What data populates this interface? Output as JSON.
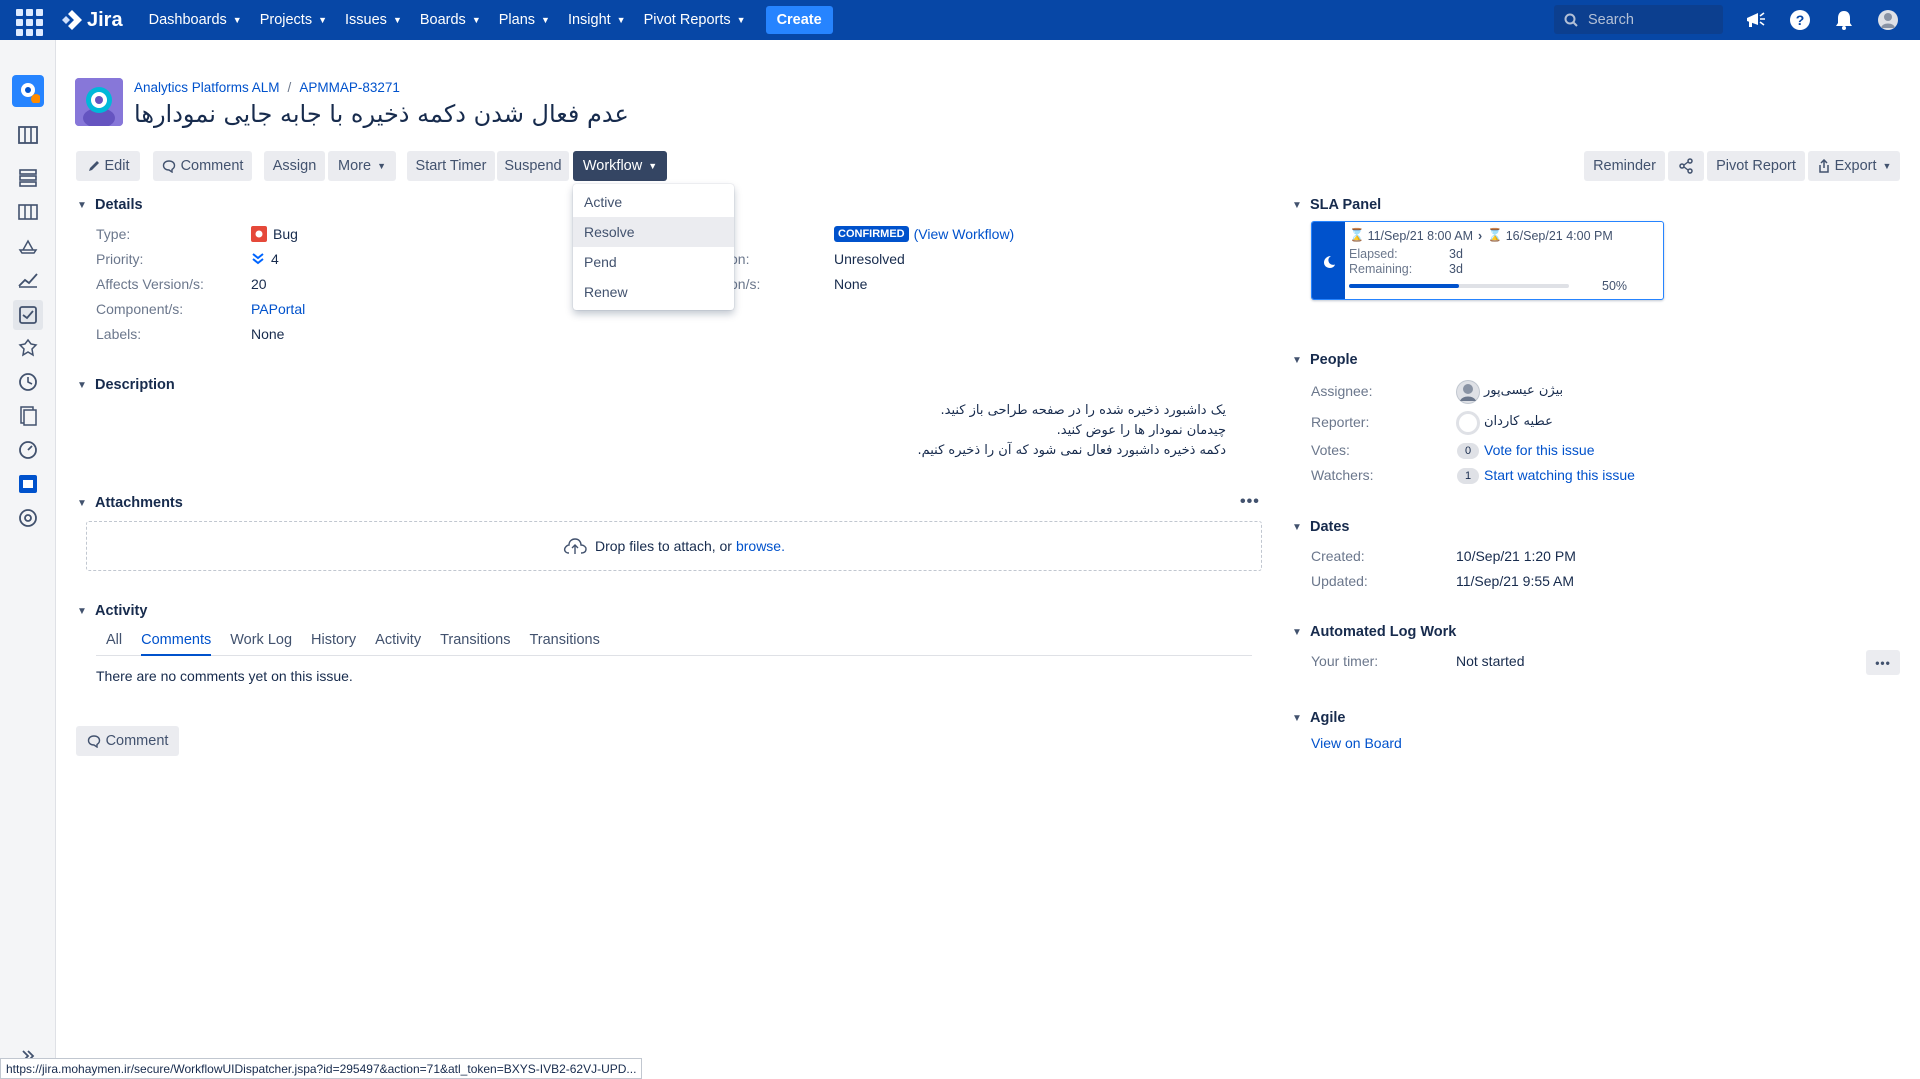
{
  "nav": {
    "brand": "Jira",
    "items": [
      "Dashboards",
      "Projects",
      "Issues",
      "Boards",
      "Plans",
      "Insight",
      "Pivot Reports"
    ],
    "create_label": "Create",
    "search_placeholder": "Search"
  },
  "sidebar": {
    "icons": [
      "project-avatar-icon",
      "board-icon",
      "backlog-icon",
      "columns-icon",
      "releases-icon",
      "reports-icon",
      "issues-icon",
      "components-icon",
      "timer-icon",
      "pages-icon",
      "dashboard-gauge-icon",
      "insight-icon",
      "settings-icon"
    ],
    "expand_icon": "double-chevron-right-icon"
  },
  "header": {
    "project_name": "Analytics Platforms ALM",
    "issue_key": "APMMAP-83271",
    "title": "عدم فعال شدن دکمه ذخیره با جابه جایی نمودارها"
  },
  "toolbar": {
    "edit": "Edit",
    "comment": "Comment",
    "assign": "Assign",
    "more": "More",
    "start_timer": "Start Timer",
    "suspend": "Suspend",
    "workflow": "Workflow",
    "reminder": "Reminder",
    "pivot_report": "Pivot Report",
    "export": "Export"
  },
  "workflow_menu": {
    "items": [
      "Active",
      "Resolve",
      "Pend",
      "Renew"
    ],
    "hovered": "Resolve"
  },
  "details": {
    "heading": "Details",
    "type_label": "Type:",
    "type_value": "Bug",
    "priority_label": "Priority:",
    "priority_value": "4",
    "affects_label": "Affects Version/s:",
    "affects_value": "20",
    "component_label": "Component/s:",
    "component_value": "PAPortal",
    "labels_label": "Labels:",
    "labels_value": "None",
    "status_badge": "CONFIRMED",
    "view_workflow": "(View Workflow)",
    "resolution_label_partial": "on:",
    "resolution_value": "Unresolved",
    "fix_label_partial": "on/s:",
    "fix_value": "None"
  },
  "description": {
    "heading": "Description",
    "lines": [
      "یک داشبورد ذخیره شده را در صفحه طراحی باز کنید.",
      "چیدمان نمودار ها را عوض کنید.",
      "دکمه ذخیره داشبورد فعال نمی شود که آن را ذخیره کنیم."
    ]
  },
  "attachments": {
    "heading": "Attachments",
    "drop_text": "Drop files to attach, or",
    "browse": "browse."
  },
  "activity": {
    "heading": "Activity",
    "tabs": [
      "All",
      "Comments",
      "Work Log",
      "History",
      "Activity",
      "Transitions",
      "Transitions"
    ],
    "active_tab": "Comments",
    "empty_text": "There are no comments yet on this issue.",
    "comment_button": "Comment"
  },
  "sla": {
    "heading": "SLA Panel",
    "start": "11/Sep/21 8:00 AM",
    "end": "16/Sep/21 4:00 PM",
    "elapsed_label": "Elapsed:",
    "elapsed_value": "3d",
    "remaining_label": "Remaining:",
    "remaining_value": "3d",
    "percent_label": "50%",
    "progress_fraction": 0.5
  },
  "people": {
    "heading": "People",
    "assignee_label": "Assignee:",
    "assignee_value": "بیژن عیسی‌پور",
    "reporter_label": "Reporter:",
    "reporter_value": "عطیه کاردان",
    "votes_label": "Votes:",
    "votes_count": "0",
    "votes_link": "Vote for this issue",
    "watchers_label": "Watchers:",
    "watchers_count": "1",
    "watchers_link": "Start watching this issue"
  },
  "dates": {
    "heading": "Dates",
    "created_label": "Created:",
    "created_value": "10/Sep/21 1:20 PM",
    "updated_label": "Updated:",
    "updated_value": "11/Sep/21 9:55 AM"
  },
  "logwork": {
    "heading": "Automated Log Work",
    "timer_label": "Your timer:",
    "timer_value": "Not started"
  },
  "agile": {
    "heading": "Agile",
    "link": "View on Board"
  },
  "status_url": "https://jira.mohaymen.ir/secure/WorkflowUIDispatcher.jspa?id=295497&action=71&atl_token=BXYS-IVB2-62VJ-UPD...",
  "colors": {
    "nav_bg": "#0747a6",
    "create_bg": "#2684ff",
    "link": "#0052cc",
    "bug": "#e5493a",
    "confirmed_badge": "#0052cc"
  }
}
